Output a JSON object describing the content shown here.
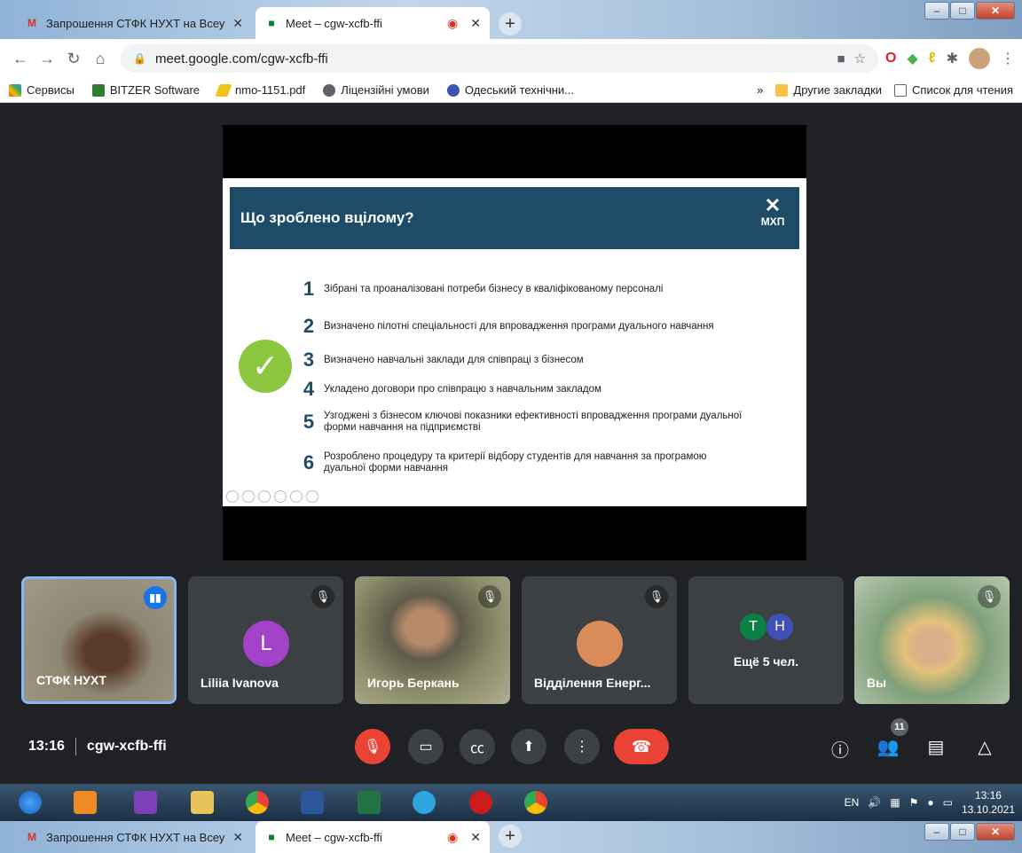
{
  "browser": {
    "tabs": [
      {
        "label": "Запрошення СТФК НУХТ на Всеу",
        "icon": "gmail-icon"
      },
      {
        "label": "Meet – cgw-xcfb-ffi",
        "icon": "meet-icon"
      }
    ],
    "url": "meet.google.com/cgw-xcfb-ffi",
    "bookmarks": [
      {
        "label": "Сервисы"
      },
      {
        "label": "BITZER Software"
      },
      {
        "label": "nmo-1151.pdf"
      },
      {
        "label": "Ліцензійні умови"
      },
      {
        "label": "Одеський технічни..."
      }
    ],
    "bookmarks_more": "»",
    "other_bookmarks": "Другие закладки",
    "reading_list": "Список для чтения"
  },
  "slide": {
    "title": "Що зроблено вцілому?",
    "logo_text": "МХП",
    "items": [
      {
        "num": "1",
        "text": "Зібрані та проаналізовані потреби бізнесу в кваліфікованому персоналі"
      },
      {
        "num": "2",
        "text": "Визначено пілотні спеціальності для впровадження програми дуального навчання"
      },
      {
        "num": "3",
        "text": "Визначено навчальні заклади для співпраці з бізнесом"
      },
      {
        "num": "4",
        "text": "Укладено договори про співпрацю з навчальним закладом"
      },
      {
        "num": "5",
        "text": "Узгоджені з бізнесом ключові показники ефективності впровадження програми дуальної форми навчання на підприємстві"
      },
      {
        "num": "6",
        "text": "Розроблено процедуру та критерії відбору студентів для навчання за програмою дуальної форми навчання"
      }
    ]
  },
  "participants": [
    {
      "name": "СТФК НУХТ"
    },
    {
      "name": "Liliia Ivanova",
      "initial": "L"
    },
    {
      "name": "Игорь Беркань"
    },
    {
      "name": "Відділення Енерг..."
    },
    {
      "name": "Ещё 5 чел.",
      "initials": [
        "Т",
        "Н"
      ]
    },
    {
      "name": "Вы"
    }
  ],
  "meeting": {
    "time": "13:16",
    "code": "cgw-xcfb-ffi",
    "people_count": "11"
  },
  "taskbar": {
    "lang": "EN",
    "time": "13:16",
    "date": "13.10.2021"
  },
  "colors": {
    "slide_header": "#1e4c66",
    "check": "#8dc63f",
    "hangup": "#ea4335"
  }
}
